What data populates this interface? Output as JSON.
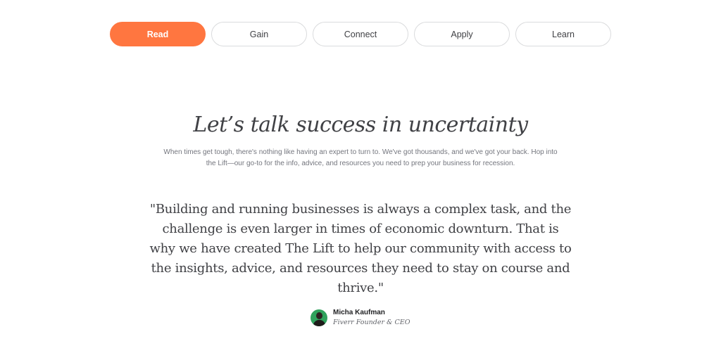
{
  "tabs": [
    {
      "label": "Read",
      "active": true
    },
    {
      "label": "Gain",
      "active": false
    },
    {
      "label": "Connect",
      "active": false
    },
    {
      "label": "Apply",
      "active": false
    },
    {
      "label": "Learn",
      "active": false
    }
  ],
  "colors": {
    "accent": "#ff7640",
    "text": "#404145",
    "muted": "#74767e"
  },
  "hero": {
    "title": "Let’s talk success in uncertainty",
    "subtitle": "When times get tough, there's nothing like having an expert to turn to. We've got thousands, and we've got your back. Hop into the Lift—our go-to for the info, advice, and resources you need to prep your business for recession."
  },
  "testimonial": {
    "quote": "\"Building and running businesses is always a complex task, and the challenge is even larger in times of economic downturn. That is why we have created The Lift to help our community with access to the insights, advice, and resources they need to stay on course and thrive.\"",
    "author_name": "Micha Kaufman",
    "author_role": "Fiverr Founder & CEO",
    "avatar_icon": "person-avatar"
  }
}
